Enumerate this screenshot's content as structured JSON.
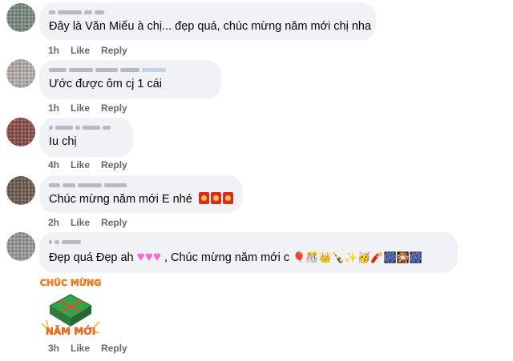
{
  "comments": [
    {
      "id": "c1",
      "author": "",
      "text": "Đây là Văn Miếu à chị... đẹp quá, chúc mừng năm mới chị nha",
      "time": "1h",
      "like": "Like",
      "reply": "Reply",
      "avatar_color": "#7a8c7e"
    },
    {
      "id": "c2",
      "author": "",
      "text": "Ước được ôm cj 1 cái",
      "time": "1h",
      "like": "Like",
      "reply": "Reply",
      "avatar_color": "#b7b2ad"
    },
    {
      "id": "c3",
      "author": "",
      "text": "Iu chị",
      "time": "4h",
      "like": "Like",
      "reply": "Reply",
      "avatar_color": "#8b4a45"
    },
    {
      "id": "c4",
      "author": "",
      "text": "Chúc mừng năm mới E nhé",
      "time": "2h",
      "like": "Like",
      "reply": "Reply",
      "avatar_color": "#6c5a4c"
    },
    {
      "id": "c5",
      "author": "",
      "text_before": "Đẹp quá Đẹp ah",
      "text_after": ", Chúc mừng năm mới c",
      "emoji_tail": "🎈🎊👑🍾✨🥳🧨🎆🎇🎆",
      "sticker_text_1": "CHÚC MỪNG",
      "sticker_text_2": "NĂM MỚI",
      "time": "3h",
      "like": "Like",
      "reply": "Reply",
      "avatar_color": "#9a9a9a"
    }
  ],
  "colors": {
    "bubble_bg": "#f0f2f5",
    "meta_text": "#65676b",
    "heart": "#f06bd6",
    "envelope": "#d92d20"
  }
}
